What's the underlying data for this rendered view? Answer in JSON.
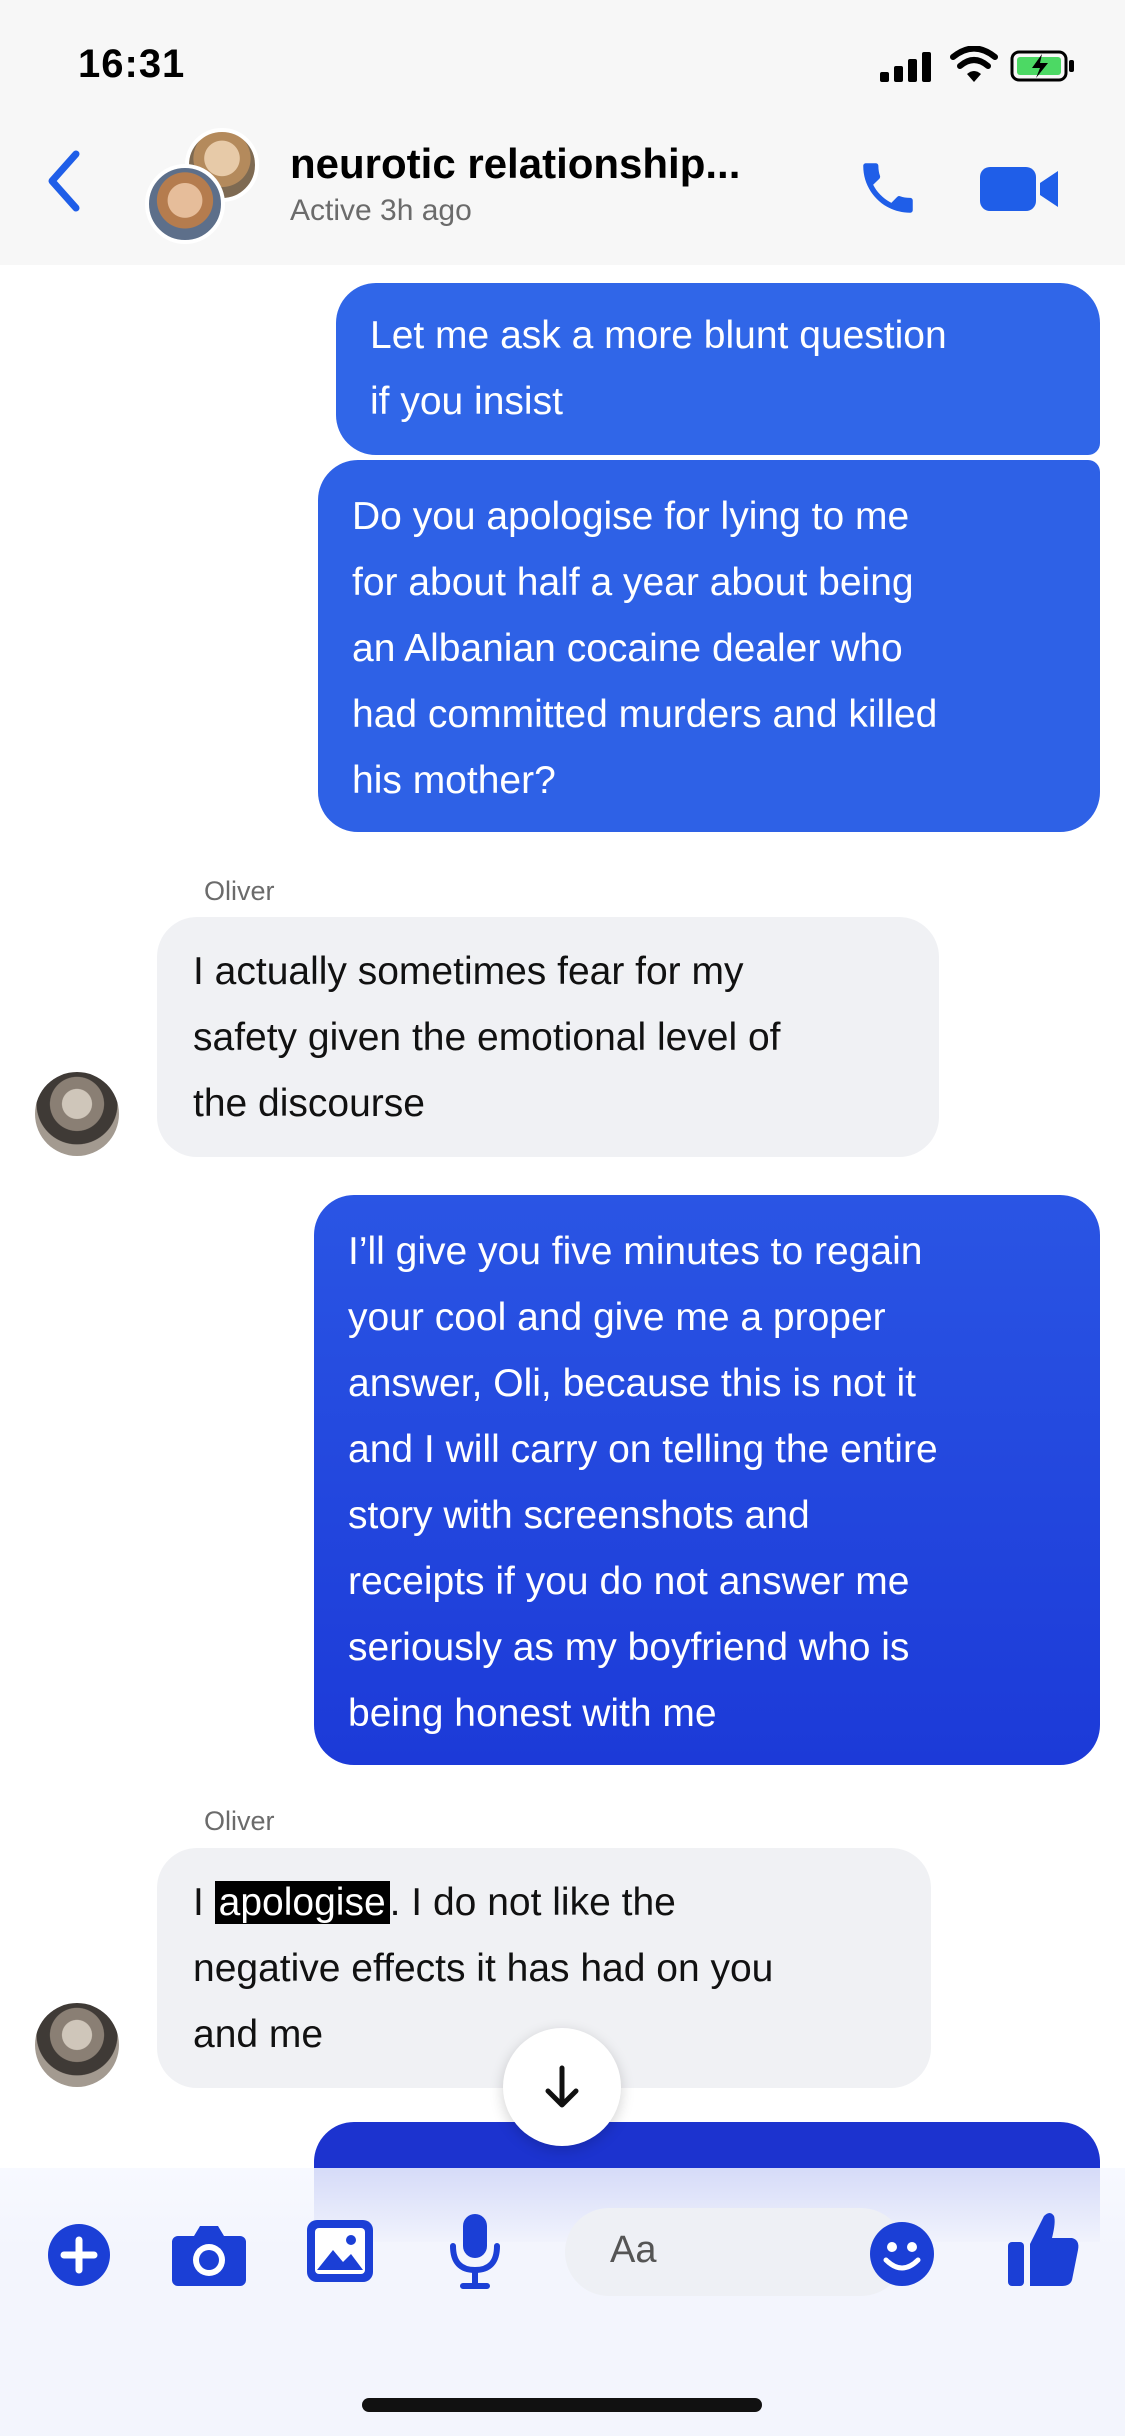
{
  "status_bar": {
    "time": "16:31"
  },
  "header": {
    "title": "neurotic relationship...",
    "subtitle": "Active 3h ago"
  },
  "messages": [
    {
      "from": "me",
      "text_lines": [
        "Let me ask a more blunt question",
        "if you insist"
      ]
    },
    {
      "from": "me",
      "text_lines": [
        "Do you apologise for lying to me",
        "for about half a year about being",
        "an Albanian cocaine dealer who",
        "had committed murders and killed",
        "his mother?"
      ]
    },
    {
      "from": "Oliver",
      "sender": "Oliver",
      "text_lines": [
        "I actually sometimes fear for my",
        "safety given the emotional level of",
        "the discourse"
      ]
    },
    {
      "from": "me",
      "text_lines": [
        "I’ll give you five minutes to regain",
        "your cool and give me a proper",
        "answer, Oli, because this is not it",
        "and I will carry on telling the entire",
        "story with screenshots and",
        "receipts if you do not answer me",
        "seriously as my boyfriend who is",
        "being honest with me"
      ]
    },
    {
      "from": "Oliver",
      "sender": "Oliver",
      "text_lines": [
        "I ",
        "apologise",
        ". I do not like the",
        "negative effects it has had on you",
        "and me"
      ]
    }
  ],
  "composer": {
    "placeholder": "Aa"
  },
  "colors": {
    "accent": "#1b3fd6",
    "outgoing_bubble": "#2e61e6",
    "incoming_bubble": "#f0f1f4"
  },
  "icons": [
    "back-chevron-icon",
    "phone-icon",
    "video-camera-icon",
    "plus-icon",
    "camera-icon",
    "gallery-icon",
    "microphone-icon",
    "emoji-icon",
    "thumbs-up-icon",
    "arrow-down-icon"
  ]
}
